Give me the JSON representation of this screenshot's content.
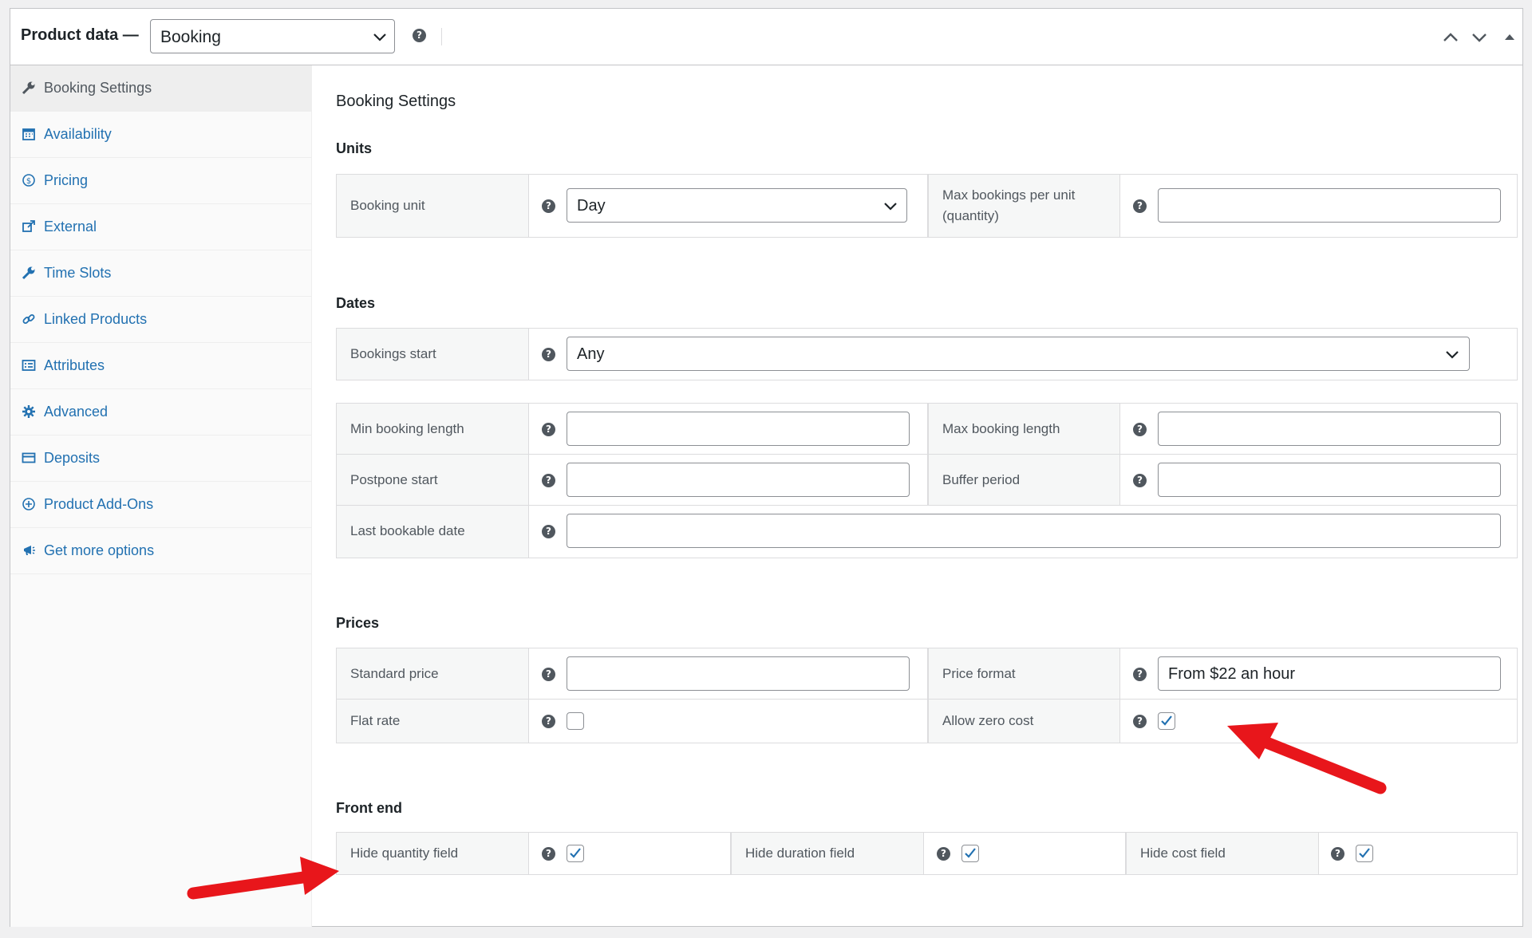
{
  "header": {
    "title": "Product data —",
    "product_type": "Booking"
  },
  "sidebar": {
    "items": [
      {
        "label": "Booking Settings",
        "icon": "wrench-icon",
        "active": true
      },
      {
        "label": "Availability",
        "icon": "calendar-icon"
      },
      {
        "label": "Pricing",
        "icon": "dollar-circle-icon"
      },
      {
        "label": "External",
        "icon": "external-link-icon"
      },
      {
        "label": "Time Slots",
        "icon": "wrench-icon"
      },
      {
        "label": "Linked Products",
        "icon": "link-icon"
      },
      {
        "label": "Attributes",
        "icon": "list-icon"
      },
      {
        "label": "Advanced",
        "icon": "gear-icon"
      },
      {
        "label": "Deposits",
        "icon": "card-icon"
      },
      {
        "label": "Product Add-Ons",
        "icon": "plus-circle-icon"
      },
      {
        "label": "Get more options",
        "icon": "megaphone-icon"
      }
    ]
  },
  "main": {
    "title": "Booking Settings",
    "units": {
      "heading": "Units",
      "booking_unit_label": "Booking unit",
      "booking_unit_value": "Day",
      "max_bookings_label_line1": "Max bookings per unit",
      "max_bookings_label_line2": "(quantity)",
      "max_bookings_value": ""
    },
    "dates": {
      "heading": "Dates",
      "bookings_start_label": "Bookings start",
      "bookings_start_value": "Any",
      "min_length_label": "Min booking length",
      "max_length_label": "Max booking length",
      "postpone_label": "Postpone start",
      "buffer_label": "Buffer period",
      "last_date_label": "Last bookable date"
    },
    "prices": {
      "heading": "Prices",
      "standard_price_label": "Standard price",
      "standard_price_value": "",
      "price_format_label": "Price format",
      "price_format_value": "From $22 an hour",
      "flat_rate_label": "Flat rate",
      "flat_rate_checked": false,
      "allow_zero_label": "Allow zero cost",
      "allow_zero_checked": true
    },
    "frontend": {
      "heading": "Front end",
      "hide_quantity_label": "Hide quantity field",
      "hide_quantity_checked": true,
      "hide_duration_label": "Hide duration field",
      "hide_duration_checked": true,
      "hide_cost_label": "Hide cost field",
      "hide_cost_checked": true
    }
  },
  "colors": {
    "link": "#2271b1",
    "annotation_arrow": "#e8161b"
  }
}
